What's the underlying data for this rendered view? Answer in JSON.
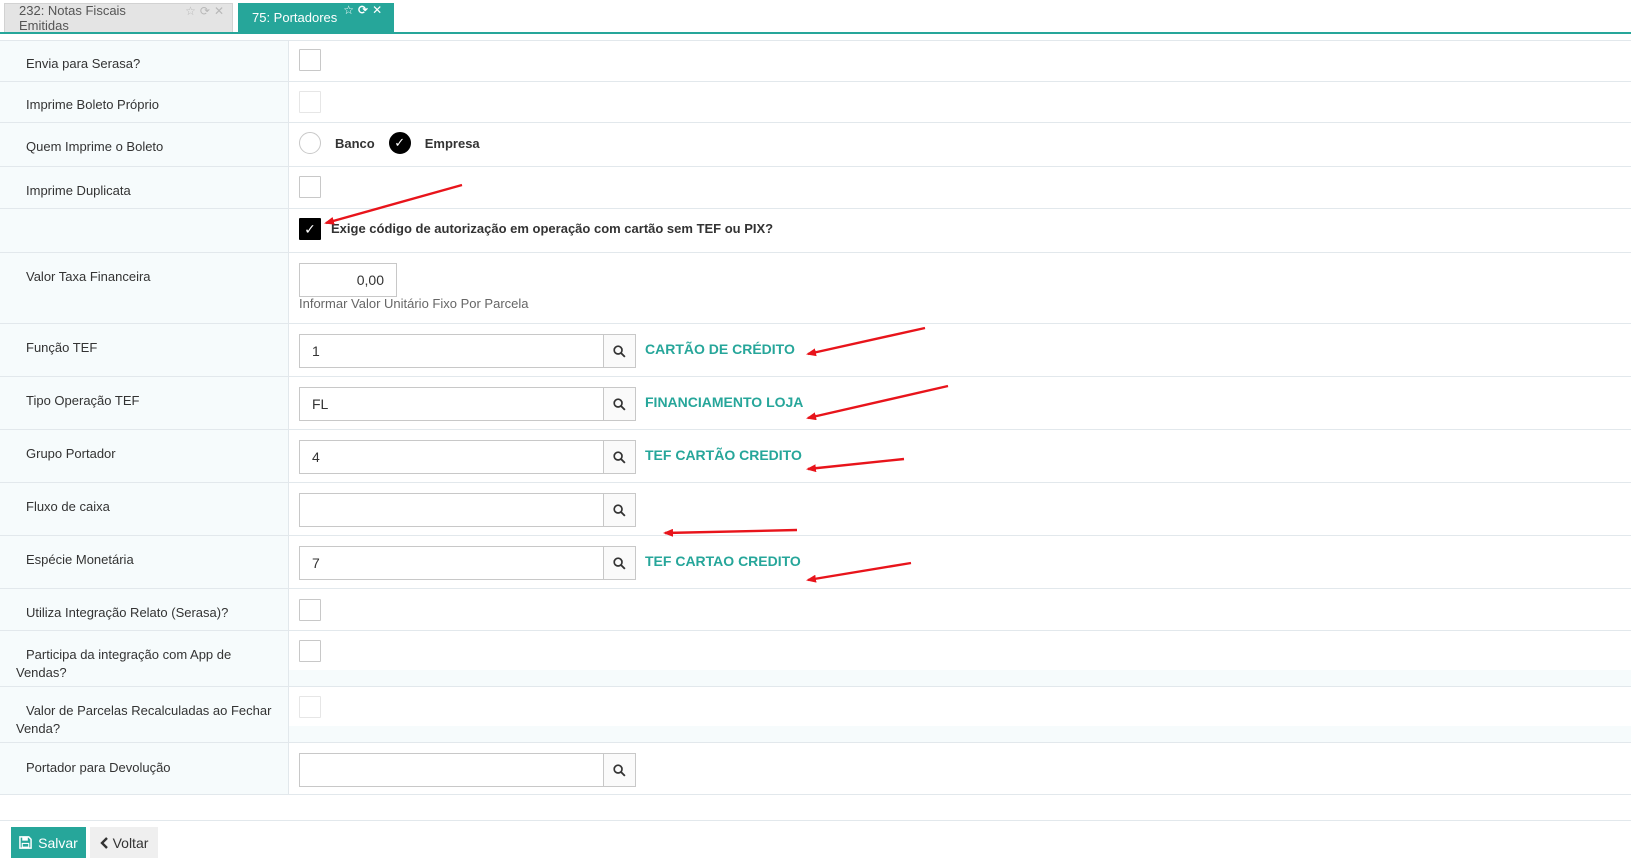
{
  "tabs": [
    {
      "label": "232: Notas Fiscais Emitidas",
      "active": false
    },
    {
      "label": "75: Portadores",
      "active": true
    }
  ],
  "icons": {
    "favorite": "star-icon",
    "refresh": "refresh-icon",
    "close": "close-icon",
    "search": "search-icon",
    "save": "floppy-disk-icon",
    "back": "chevron-left-icon"
  },
  "colors": {
    "accent": "#26a69a",
    "annotation": "#e8141b"
  },
  "fields": {
    "envia_serasa": {
      "label": "Envia para Serasa?",
      "checked": false
    },
    "imprime_boleto_proprio": {
      "label": "Imprime Boleto Próprio",
      "checked": false
    },
    "quem_imprime": {
      "label": "Quem Imprime o Boleto",
      "options": [
        "Banco",
        "Empresa"
      ],
      "selected": "Empresa"
    },
    "imprime_duplicata": {
      "label": "Imprime Duplicata",
      "checked": false
    },
    "exige_codigo": {
      "label": "Exige código de autorização em operação com cartão sem TEF ou PIX?",
      "checked": true
    },
    "valor_taxa": {
      "label": "Valor Taxa Financeira",
      "value": "0,00",
      "help": "Informar Valor Unitário Fixo Por Parcela"
    },
    "funcao_tef": {
      "label": "Função TEF",
      "value": "1",
      "description": "CARTÃO DE CRÉDITO"
    },
    "tipo_operacao_tef": {
      "label": "Tipo Operação TEF",
      "value": "FL",
      "description": "FINANCIAMENTO LOJA"
    },
    "grupo_portador": {
      "label": "Grupo Portador",
      "value": "4",
      "description": "TEF CARTÃO CREDITO"
    },
    "fluxo_caixa": {
      "label": "Fluxo de caixa",
      "value": "",
      "description": ""
    },
    "especie_monetaria": {
      "label": "Espécie Monetária",
      "value": "7",
      "description": "TEF CARTAO CREDITO"
    },
    "utiliza_relato": {
      "label": "Utiliza Integração Relato (Serasa)?",
      "checked": false
    },
    "app_vendas": {
      "label_line1": "Participa da integração com App de",
      "label_line2": "Vendas?",
      "checked": false
    },
    "parcelas_recalculadas": {
      "label_line1": "Valor de Parcelas Recalculadas ao Fechar",
      "label_line2": "Venda?",
      "checked": false
    },
    "portador_devolucao": {
      "label": "Portador para Devolução",
      "value": ""
    }
  },
  "footer": {
    "save_label": "Salvar",
    "back_label": "Voltar"
  }
}
